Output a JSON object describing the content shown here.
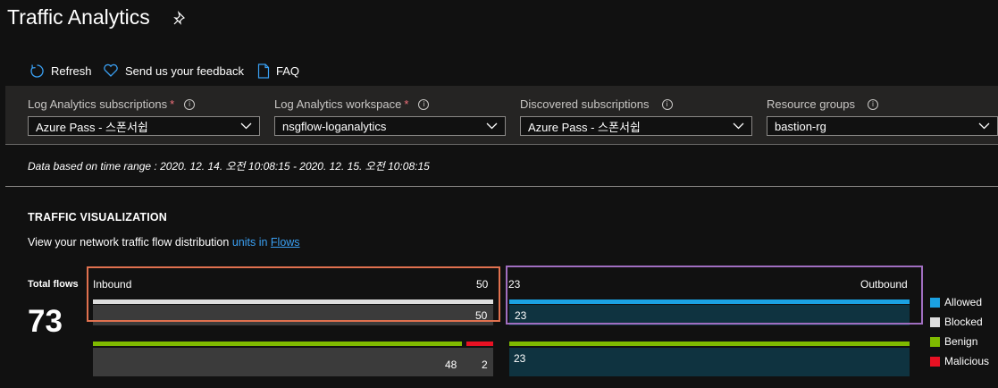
{
  "header": {
    "title": "Traffic Analytics",
    "pin_icon": "pin-icon"
  },
  "toolbar": {
    "refresh_label": "Refresh",
    "feedback_label": "Send us your feedback",
    "faq_label": "FAQ"
  },
  "filters": [
    {
      "label": "Log Analytics subscriptions",
      "required": "*",
      "value": "Azure Pass - 스폰서쉽"
    },
    {
      "label": "Log Analytics workspace",
      "required": "*",
      "value": "nsgflow-loganalytics"
    },
    {
      "label": "Discovered subscriptions",
      "required": "",
      "value": "Azure Pass - 스폰서쉽"
    },
    {
      "label": "Resource groups",
      "required": "",
      "value": "bastion-rg"
    }
  ],
  "time_range": "Data based on time range : 2020. 12. 14. 오전 10:08:15 - 2020. 12. 15. 오전 10:08:15",
  "visualization": {
    "title": "TRAFFIC VISUALIZATION",
    "subtitle_prefix": "View your network traffic flow distribution ",
    "subtitle_units": "units in ",
    "subtitle_link": "Flows",
    "total_label": "Total flows",
    "total_value": "73",
    "inbound": {
      "label": "Inbound",
      "total": "50",
      "blocked": "50",
      "benign": "48",
      "malicious": "2"
    },
    "outbound": {
      "label": "Outbound",
      "total": "23",
      "allowed": "23",
      "benign": "23"
    },
    "legend": [
      {
        "name": "Allowed",
        "color": "#1ba1e2"
      },
      {
        "name": "Blocked",
        "color": "#dddddd"
      },
      {
        "name": "Benign",
        "color": "#7fba00"
      },
      {
        "name": "Malicious",
        "color": "#e81123"
      }
    ]
  },
  "colors": {
    "allowed": "#1ba1e2",
    "blocked": "#dddddd",
    "benign": "#7fba00",
    "malicious": "#e81123",
    "inbound_selection": "#e0714f",
    "outbound_selection": "#a06ec0"
  }
}
